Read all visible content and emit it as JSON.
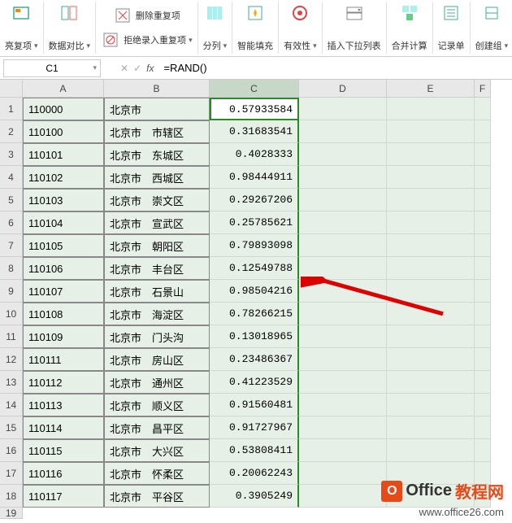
{
  "ribbon": {
    "highlight_duplicates": "亮复项",
    "data_compare": "数据对比",
    "remove_duplicates": "删除重复项",
    "block_duplicates": "拒绝录入重复项",
    "text_to_cols": "分列",
    "flash_fill": "智能填充",
    "validation": "有效性",
    "insert_dropdown": "插入下拉列表",
    "consolidate": "合并计算",
    "record_form": "记录单",
    "create_group": "创建组"
  },
  "formula_bar": {
    "name_box": "C1",
    "fx_label": "fx",
    "formula": "=RAND()"
  },
  "columns": [
    "A",
    "B",
    "C",
    "D",
    "E",
    "F"
  ],
  "rows": [
    {
      "n": "1",
      "a": "110000",
      "b": "北京市",
      "c": "0.57933584"
    },
    {
      "n": "2",
      "a": "110100",
      "b": "北京市　市辖区",
      "c": "0.31683541"
    },
    {
      "n": "3",
      "a": "110101",
      "b": "北京市　东城区",
      "c": "0.4028333"
    },
    {
      "n": "4",
      "a": "110102",
      "b": "北京市　西城区",
      "c": "0.98444911"
    },
    {
      "n": "5",
      "a": "110103",
      "b": "北京市　崇文区",
      "c": "0.29267206"
    },
    {
      "n": "6",
      "a": "110104",
      "b": "北京市　宣武区",
      "c": "0.25785621"
    },
    {
      "n": "7",
      "a": "110105",
      "b": "北京市　朝阳区",
      "c": "0.79893098"
    },
    {
      "n": "8",
      "a": "110106",
      "b": "北京市　丰台区",
      "c": "0.12549788"
    },
    {
      "n": "9",
      "a": "110107",
      "b": "北京市　石景山",
      "c": "0.98504216"
    },
    {
      "n": "10",
      "a": "110108",
      "b": "北京市　海淀区",
      "c": "0.78266215"
    },
    {
      "n": "11",
      "a": "110109",
      "b": "北京市　门头沟",
      "c": "0.13018965"
    },
    {
      "n": "12",
      "a": "110111",
      "b": "北京市　房山区",
      "c": "0.23486367"
    },
    {
      "n": "13",
      "a": "110112",
      "b": "北京市　通州区",
      "c": "0.41223529"
    },
    {
      "n": "14",
      "a": "110113",
      "b": "北京市　顺义区",
      "c": "0.91560481"
    },
    {
      "n": "15",
      "a": "110114",
      "b": "北京市　昌平区",
      "c": "0.91727967"
    },
    {
      "n": "16",
      "a": "110115",
      "b": "北京市　大兴区",
      "c": "0.53808411"
    },
    {
      "n": "17",
      "a": "110116",
      "b": "北京市　怀柔区",
      "c": "0.20062243"
    },
    {
      "n": "18",
      "a": "110117",
      "b": "北京市　平谷区",
      "c": "0.3905249"
    }
  ],
  "extra_row": "19",
  "watermark": {
    "text_prefix": "Office",
    "text_suffix": "教程网",
    "url": "www.office26.com"
  }
}
